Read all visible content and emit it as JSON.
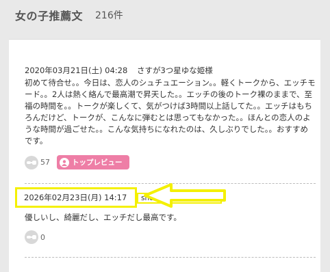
{
  "header": {
    "title": "女の子推薦文",
    "count": "216件"
  },
  "reviews": [
    {
      "date": "2020年03月21日(土) 04:28",
      "user": "さすが3つ星ゆな姫様",
      "text": "初めて待合せ。。今日は、恋人のシュチュエーション。。軽くトークから、エッチモード。。2人は熱く絡んで最高潮で昇天した。。エッチの後のトーク裸のままで、至福の時間を。。トークが楽しくて、気がつけば3時間以上話してた。。エッチはもちろんだけど、トークが、こんなに弾むとは思ってもなかった。。ほんとの恋人のような時間が過ごせた。。こんな気持ちになれたのは、久しぶりでした。。おすすめです。",
      "likes": "57",
      "badge": "トップレビュー"
    },
    {
      "date": "2026年02月23日(月) 14:17",
      "user": "snd2pqg0gvRu様",
      "text": "優しいし、綺麗だし、エッチだし最高です。",
      "likes": "0"
    }
  ],
  "icons": {
    "like": "fist-bump-icon",
    "badge": "person-icon"
  },
  "colors": {
    "badge_bg": "#ee7ea6",
    "highlight": "#f4f000"
  }
}
